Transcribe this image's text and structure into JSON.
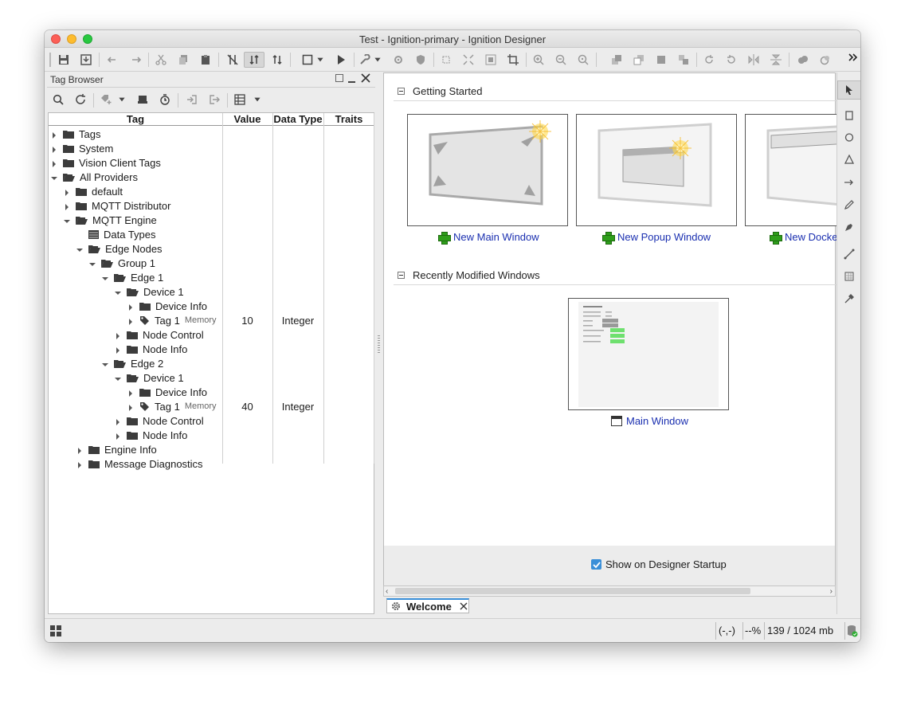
{
  "window": {
    "title": "Test - Ignition-primary - Ignition Designer"
  },
  "tag_browser": {
    "title": "Tag Browser",
    "columns": [
      "Tag",
      "Value",
      "Data Type",
      "Traits"
    ],
    "rows": [
      {
        "label": "Tags",
        "level": 0,
        "caret": "right",
        "icon": "folder",
        "value": "",
        "type": ""
      },
      {
        "label": "System",
        "level": 0,
        "caret": "right",
        "icon": "folder",
        "value": "",
        "type": ""
      },
      {
        "label": "Vision Client Tags",
        "level": 0,
        "caret": "right",
        "icon": "folder",
        "value": "",
        "type": ""
      },
      {
        "label": "All Providers",
        "level": 0,
        "caret": "down",
        "icon": "folder-open",
        "value": "",
        "type": ""
      },
      {
        "label": "default",
        "level": 1,
        "caret": "right",
        "icon": "folder",
        "value": "",
        "type": ""
      },
      {
        "label": "MQTT Distributor",
        "level": 1,
        "caret": "right",
        "icon": "folder",
        "value": "",
        "type": ""
      },
      {
        "label": "MQTT Engine",
        "level": 1,
        "caret": "down",
        "icon": "folder-open",
        "value": "",
        "type": ""
      },
      {
        "label": "Data Types",
        "level": 2,
        "caret": "none",
        "icon": "datatypes",
        "value": "",
        "type": ""
      },
      {
        "label": "Edge Nodes",
        "level": 2,
        "caret": "down",
        "icon": "folder-open",
        "value": "",
        "type": ""
      },
      {
        "label": "Group 1",
        "level": 3,
        "caret": "down",
        "icon": "folder-open",
        "value": "",
        "type": ""
      },
      {
        "label": "Edge 1",
        "level": 4,
        "caret": "down",
        "icon": "folder-open",
        "value": "",
        "type": ""
      },
      {
        "label": "Device 1",
        "level": 5,
        "caret": "down",
        "icon": "folder-open",
        "value": "",
        "type": ""
      },
      {
        "label": "Device Info",
        "level": 6,
        "caret": "right",
        "icon": "folder",
        "value": "",
        "type": ""
      },
      {
        "label": "Tag 1",
        "level": 6,
        "caret": "right",
        "icon": "tag",
        "trait": "Memory",
        "value": "10",
        "type": "Integer"
      },
      {
        "label": "Node Control",
        "level": 5,
        "caret": "right",
        "icon": "folder",
        "value": "",
        "type": ""
      },
      {
        "label": "Node Info",
        "level": 5,
        "caret": "right",
        "icon": "folder",
        "value": "",
        "type": ""
      },
      {
        "label": "Edge 2",
        "level": 4,
        "caret": "down",
        "icon": "folder-open",
        "value": "",
        "type": ""
      },
      {
        "label": "Device 1",
        "level": 5,
        "caret": "down",
        "icon": "folder-open",
        "value": "",
        "type": ""
      },
      {
        "label": "Device Info",
        "level": 6,
        "caret": "right",
        "icon": "folder",
        "value": "",
        "type": ""
      },
      {
        "label": "Tag 1",
        "level": 6,
        "caret": "right",
        "icon": "tag",
        "trait": "Memory",
        "value": "40",
        "type": "Integer"
      },
      {
        "label": "Node Control",
        "level": 5,
        "caret": "right",
        "icon": "folder",
        "value": "",
        "type": ""
      },
      {
        "label": "Node Info",
        "level": 5,
        "caret": "right",
        "icon": "folder",
        "value": "",
        "type": ""
      },
      {
        "label": "Engine Info",
        "level": 2,
        "caret": "right",
        "icon": "folder",
        "value": "",
        "type": ""
      },
      {
        "label": "Message Diagnostics",
        "level": 2,
        "caret": "right",
        "icon": "folder",
        "value": "",
        "type": ""
      }
    ]
  },
  "welcome": {
    "getting_started": "Getting Started",
    "cards": [
      {
        "label": "New Main Window"
      },
      {
        "label": "New Popup Window"
      },
      {
        "label": "New Docke"
      }
    ],
    "recent_title": "Recently Modified Windows",
    "recent": [
      {
        "label": "Main Window"
      }
    ],
    "show_on_startup": "Show on Designer Startup",
    "tab_label": "Welcome"
  },
  "status": {
    "coords": "(-,-)",
    "zoom": "--%",
    "memory": "139 / 1024 mb"
  },
  "colors": {
    "link": "#1a2fb0",
    "accent_check": "#3a8fd8",
    "plus_green": "#2f9e1b"
  }
}
